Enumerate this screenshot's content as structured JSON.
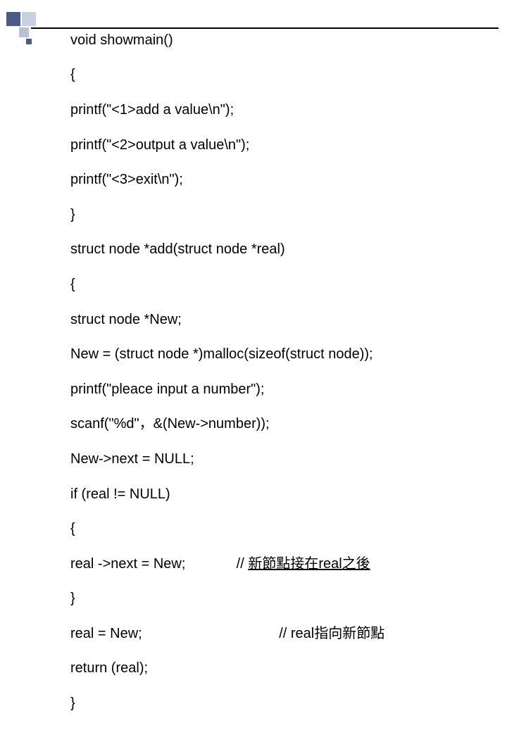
{
  "code": {
    "lines": [
      "void showmain()",
      "{",
      "printf(\"<1>add a value\\n\");",
      "printf(\"<2>output a value\\n\");",
      "printf(\"<3>exit\\n\");",
      "}",
      "struct node *add(struct node *real)",
      "{",
      "struct node *New;",
      "New = (struct node *)malloc(sizeof(struct node));",
      "printf(\"pleace input a number\");",
      "scanf(\"%d\"，&(New->number));",
      "New->next = NULL;",
      "if (real != NULL)",
      "{"
    ],
    "line16_left": "real ->next = New;             // ",
    "line16_comment": "新節點接在real之後",
    "lines_after": [
      "}",
      "real = New;                                   // real指向新節點",
      "return (real);",
      "}"
    ]
  }
}
